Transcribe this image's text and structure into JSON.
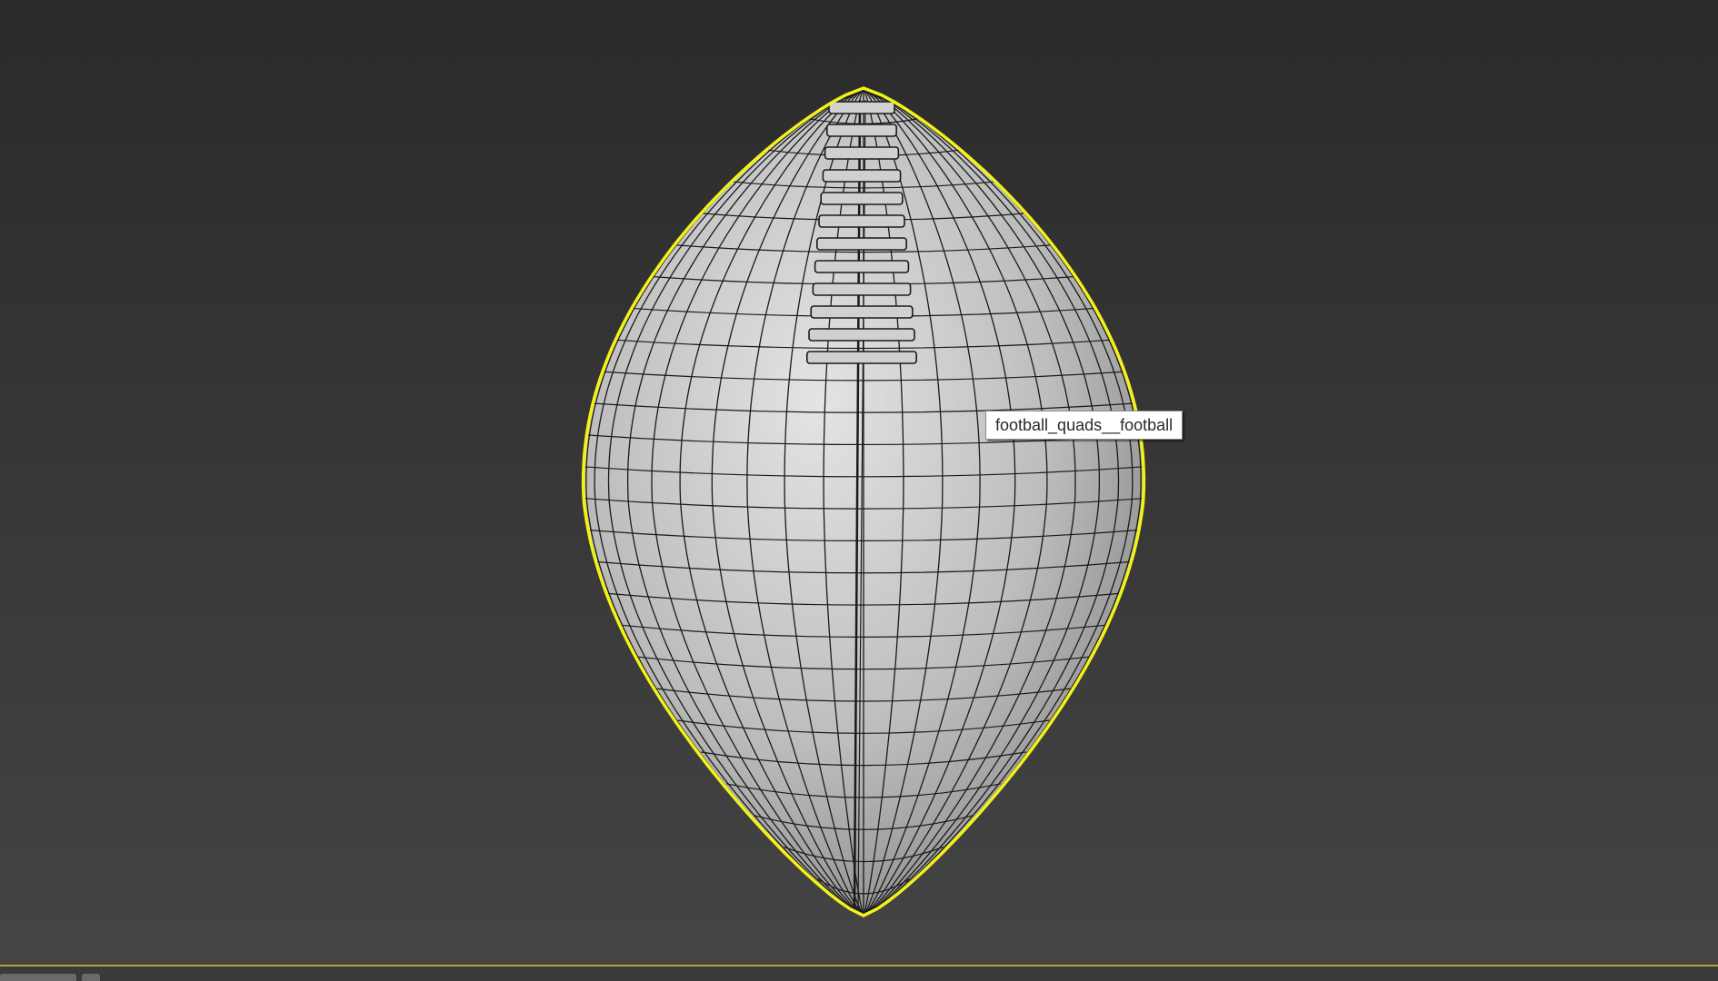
{
  "viewport": {
    "background_top": "#2b2b2b",
    "background_bottom": "#454545"
  },
  "model": {
    "selection_color": "#f2f21a",
    "wire_color": "#1a1a1a",
    "surface_light": "#d8d8d8",
    "surface_dark": "#8e8e8e"
  },
  "tooltip": {
    "text": "football_quads__football"
  },
  "timeline": {
    "accent_color": "#b8a33a"
  }
}
